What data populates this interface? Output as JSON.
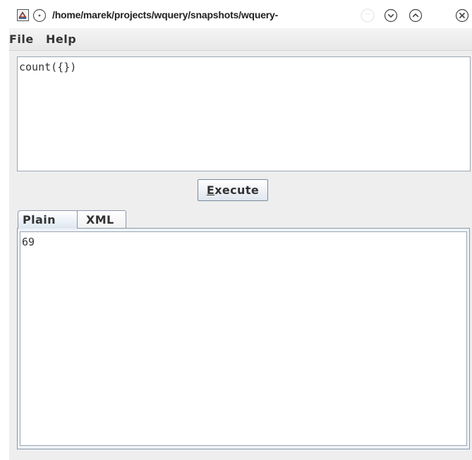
{
  "window": {
    "title": "/home/marek/projects/wquery/snapshots/wquery-",
    "icons": {
      "app": "java-app-icon",
      "sticky": "sticky-pin-icon",
      "ghost": "shade-icon",
      "minimize": "chevron-down-icon",
      "maximize": "chevron-up-icon",
      "close": "close-icon"
    }
  },
  "menu": {
    "file": "File",
    "help": "Help"
  },
  "query": {
    "text": "count({})"
  },
  "execute": {
    "mnemonic": "E",
    "rest": "xecute"
  },
  "tabs": {
    "plain": "Plain",
    "xml": "XML",
    "selected": "Plain"
  },
  "result": {
    "text": "69"
  },
  "colors": {
    "window_bg": "#eeeeee",
    "border": "#8a98a8",
    "selected_tab": "#dde7f1"
  }
}
